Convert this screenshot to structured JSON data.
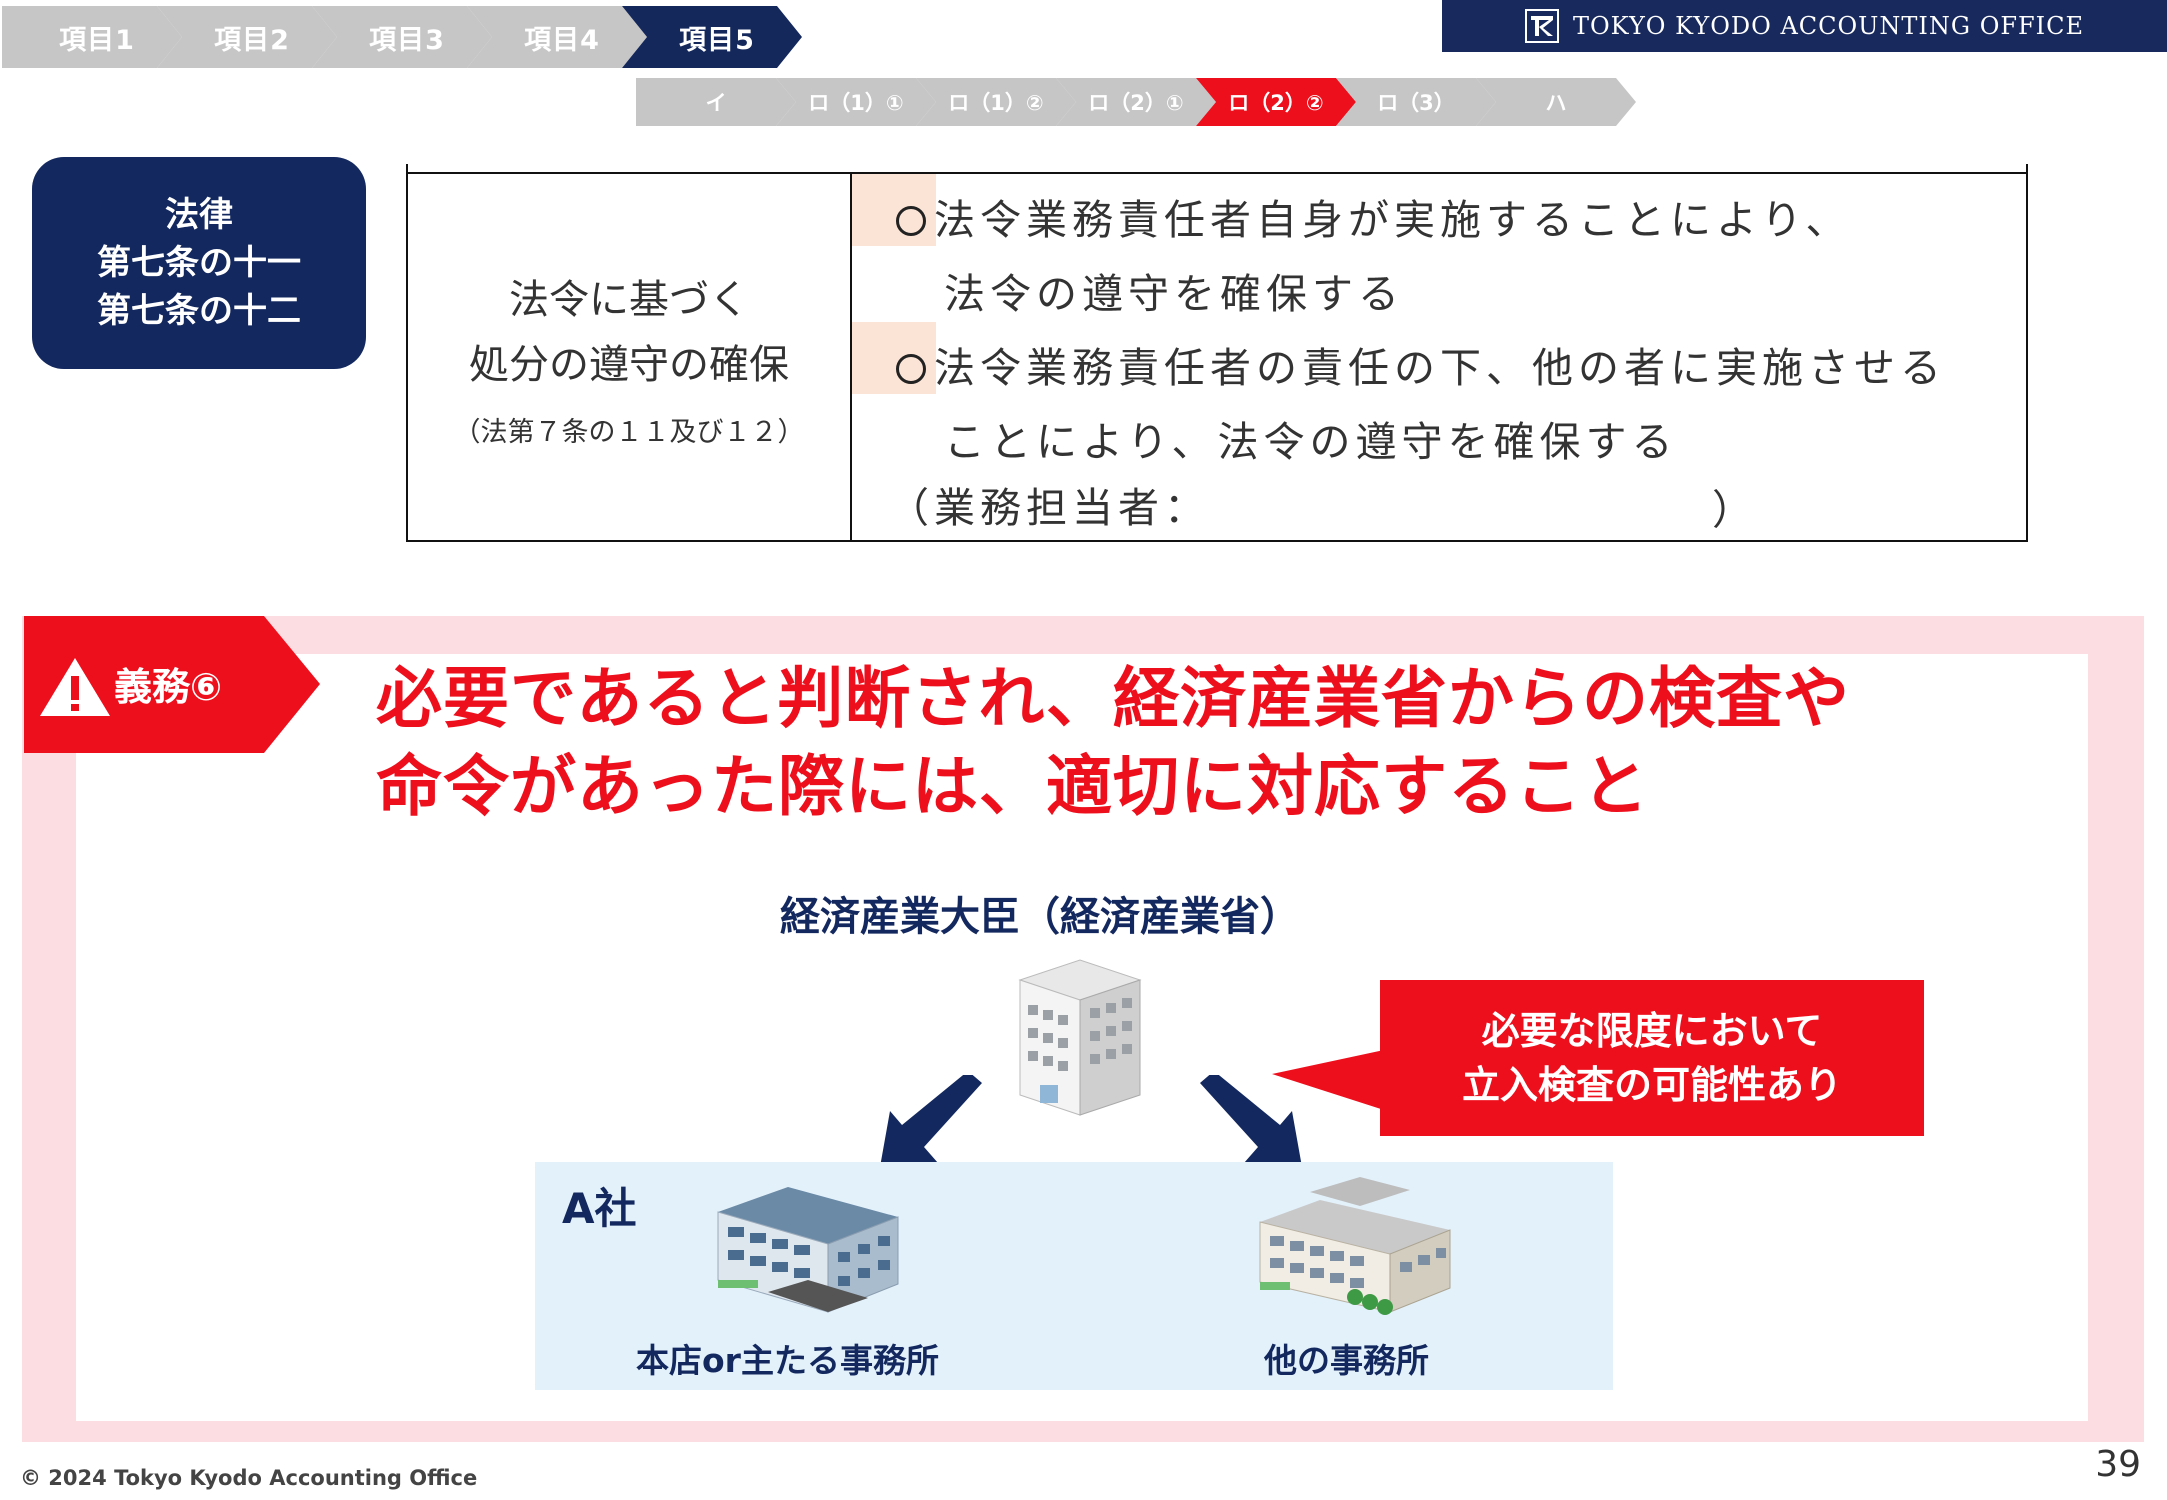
{
  "nav": {
    "steps": [
      "項目1",
      "項目2",
      "項目3",
      "項目4",
      "項目5"
    ],
    "active_step": 4,
    "substeps": [
      "イ",
      "ロ（1）①",
      "ロ（1）②",
      "ロ（2）①",
      "ロ（2）②",
      "ロ（3）",
      "ハ"
    ],
    "active_substep": 4
  },
  "banner": {
    "company": "TOKYO KYODO ACCOUNTING OFFICE"
  },
  "law_badge": {
    "lines": [
      "法律",
      "第七条の十一",
      "第七条の十二"
    ]
  },
  "law_table": {
    "left": {
      "line1": "法令に基づく",
      "line2": "処分の遵守の確保",
      "ref": "（法第７条の１１及び１２）"
    },
    "right": {
      "item1_a": "法令業務責任者自身が実施することにより、",
      "item1_b": "法令の遵守を確保する",
      "item2_a": "法令業務責任者の責任の下、他の者に実施させる",
      "item2_b": "ことにより、法令の遵守を確保する",
      "person_label": "（業務担当者：",
      "person_close": "）"
    }
  },
  "duty": {
    "tag": "義務⑥",
    "headline_line1": "必要であると判断され、経済産業省からの検査や",
    "headline_line2": "命令があった際には、適切に対応すること",
    "minister": "経済産業大臣（経済産業省）",
    "callout_line1": "必要な限度において",
    "callout_line2": "立入検査の可能性あり",
    "company": "A社",
    "building1_label": "本店or主たる事務所",
    "building2_label": "他の事務所"
  },
  "footer": {
    "copyright": "© 2024 Tokyo Kyodo Accounting Office",
    "page": "39"
  },
  "colors": {
    "navy": "#13285e",
    "red": "#ee0f1d",
    "grey_step": "#c6c6c6",
    "pink_frame": "#fcdde1",
    "light_blue": "#e3f1fb"
  }
}
